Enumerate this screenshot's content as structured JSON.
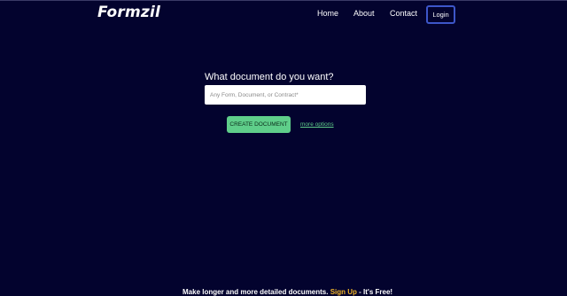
{
  "header": {
    "logo": "Formzil",
    "nav": {
      "home": "Home",
      "about": "About",
      "contact": "Contact"
    },
    "login_label": "Login"
  },
  "main": {
    "prompt": "What document do you want?",
    "search": {
      "placeholder": "Any Form, Document, or Contract*",
      "value": ""
    },
    "create_label": "CREATE DOCUMENT",
    "more_options_label": "more options"
  },
  "footer": {
    "text_before": "Make longer and more detailed documents. ",
    "signup_label": "Sign Up",
    "text_after": " - It's Free!"
  },
  "colors": {
    "background": "#03032e",
    "accent_green": "#5fce8a",
    "login_border": "#3d56c9",
    "signup_highlight": "#f0b429"
  }
}
